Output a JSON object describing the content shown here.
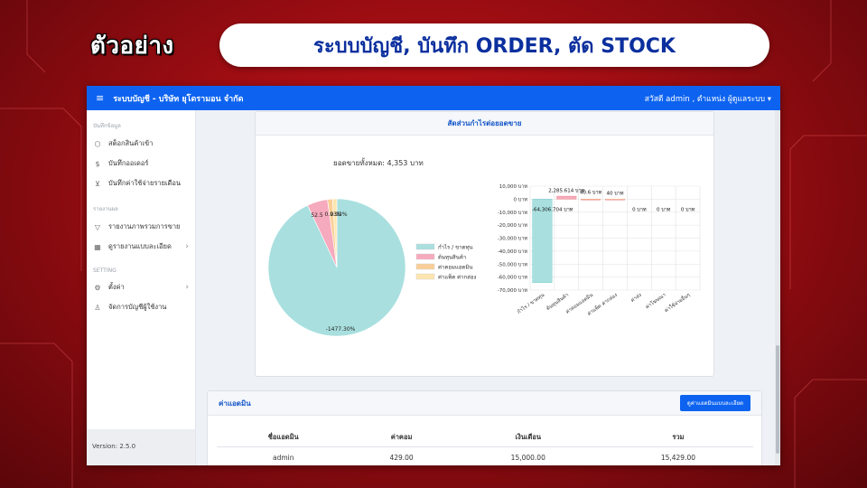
{
  "badge": "ตัวอย่าง",
  "headline": "ระบบบัญชี, บันทึก ORDER, ตัด STOCK",
  "topbar": {
    "menu_icon": "hamburger-icon",
    "title": "ระบบบัญชี - บริษัท ยุโดรามอน จำกัด",
    "user": "สวัสดี admin , ตำแหน่ง ผู้ดูแลระบบ ▾"
  },
  "sidebar": {
    "section1": "บันทึกข้อมูล",
    "items1": [
      {
        "label": "สต็อกสินค้าเข้า",
        "icon": "box-icon"
      },
      {
        "label": "บันทึกออเดอร์",
        "icon": "dollar-icon"
      },
      {
        "label": "บันทึกค่าใช้จ่ายรายเดือน",
        "icon": "cart-icon"
      }
    ],
    "section2": "รายงานผล",
    "items2": [
      {
        "label": "รายงานภาพรวมการขาย",
        "icon": "filter-icon"
      },
      {
        "label": "ดูรายงานแบบละเอียด",
        "icon": "grid-icon"
      }
    ],
    "section3": "SETTING",
    "items3": [
      {
        "label": "ตั้งค่า",
        "icon": "gear-icon"
      },
      {
        "label": "จัดการบัญชีผู้ใช้งาน",
        "icon": "user-icon"
      }
    ],
    "version": "Version: 2.5.0"
  },
  "card1": {
    "title": "สัดส่วนกำไรต่อยอดขาย",
    "total": "ยอดขายทั้งหมด: 4,353 บาท"
  },
  "chart_data": [
    {
      "type": "pie",
      "categories": [
        "กำไร / ขาดทุน",
        "ต้นทุนสินค้า",
        "ค่าคอมแอดมิน",
        "ค่าแพ็ค ค่ากล่อง"
      ],
      "values": [
        -1477.3,
        52.5,
        0.93,
        0.92
      ],
      "labels": [
        "-1477.30%",
        "52.5",
        "0.93%",
        "0.92%"
      ],
      "colors": [
        "#a9dfdf",
        "#f6aabd",
        "#f9cf98",
        "#fde6ae"
      ],
      "legend": "right"
    },
    {
      "type": "bar",
      "categories": [
        "กำไร / ขาดทุน",
        "ต้นทุนสินค้า",
        "ค่าคอมแอดมิน",
        "ค่าแพ็ค ค่ากล่อง",
        "ค่าส่ง",
        "ค่าโฆษณา",
        "ค่าใช้จ่ายอื่นๆ"
      ],
      "values": [
        -64306.704,
        2285.614,
        40.6,
        40,
        0,
        0,
        0
      ],
      "data_labels": [
        "-64,306.704 บาท",
        "2,285.614 บาท",
        "40.6 บาท",
        "40 บาท",
        "0 บาท",
        "0 บาท",
        "0 บาท"
      ],
      "colors": [
        "#a9dfdf",
        "#f6aabd",
        "#f9cf98",
        "#fde6ae",
        "#a9dfdf",
        "#a9dfdf",
        "#a9dfdf"
      ],
      "yticks": [
        "10,000 บาท",
        "0 บาท",
        "-10,000 บาท",
        "-20,000 บาท",
        "-30,000 บาท",
        "-40,000 บาท",
        "-50,000 บาท",
        "-60,000 บาท",
        "-70,000 บาท"
      ],
      "ylim": [
        -70000,
        10000
      ],
      "grid": true
    }
  ],
  "card2": {
    "title": "ค่าแอดมิน",
    "button": "ดูค่าแอดมินแบบละเอียด",
    "columns": [
      "ชื่อแอดมิน",
      "ค่าคอม",
      "เงินเดือน",
      "รวม"
    ],
    "rows": [
      [
        "admin",
        "429.00",
        "15,000.00",
        "15,429.00"
      ]
    ]
  }
}
